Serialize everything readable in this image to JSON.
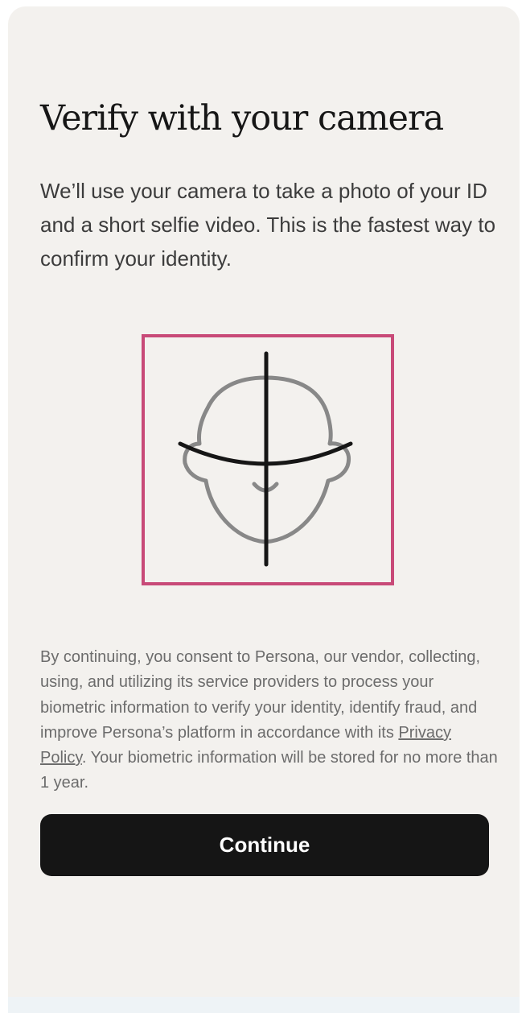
{
  "page": {
    "title": "Verify with your camera",
    "description": "We’ll use your camera to take a photo of your ID and a short selfie video. This is the fastest way to confirm your identity."
  },
  "illustration": {
    "icon": "face-scan-icon",
    "frame_color": "#c84a78"
  },
  "consent": {
    "text_before": "By continuing, you consent to Persona, our vendor, collecting, using, and utilizing its service providers to process your biometric information to verify your identity, identify fraud, and improve Persona’s platform in accordance with its ",
    "link_label": "Privacy Policy",
    "text_after": ". Your biometric information will be stored for no more than 1 year."
  },
  "actions": {
    "continue_label": "Continue"
  },
  "colors": {
    "background": "#f3f1ee",
    "button": "#151515",
    "button_text": "#ffffff"
  }
}
